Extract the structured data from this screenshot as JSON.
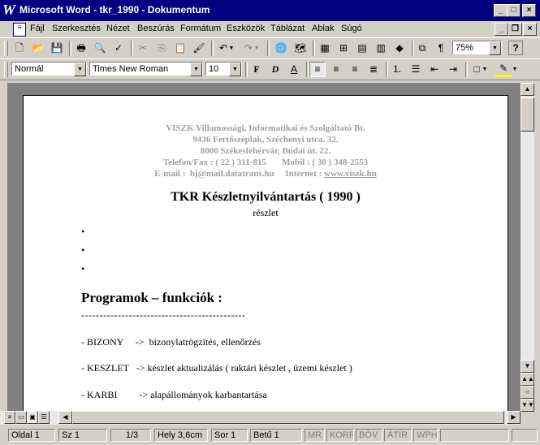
{
  "window": {
    "title": "Microsoft Word - tkr_1990 - Dokumentum",
    "app_icon": "W",
    "controls": [
      "_",
      "□",
      "×"
    ]
  },
  "doc_controls": [
    "_",
    "❐",
    "×"
  ],
  "menu": [
    "Fájl",
    "Szerkesztés",
    "Nézet",
    "Beszúrás",
    "Formátum",
    "Eszközök",
    "Táblázat",
    "Ablak",
    "Súgó"
  ],
  "toolbar": {
    "zoom": "75%",
    "help_label": "?"
  },
  "format": {
    "style": "Normál",
    "font": "Times New Roman",
    "size": "10",
    "bold_label": "F",
    "italic_label": "D",
    "underline_label": "A"
  },
  "document": {
    "header_lines": [
      "VISZK Villamossági, Informatikai és Szolgáltató Bt.",
      "9436 Fertőszéplak, Széchenyi utca. 32.",
      "8000 Székesfehérvár, Budai út. 22.",
      "Telefon/Fax : ( 22 ) 311-815       Mobil : ( 30 ) 348-2553"
    ],
    "email_line": "E-mail :  bj@mail.datatrans.hu     Internet : ",
    "website": "www.viszk.hu",
    "title": "TKR Készletnyilvántartás ( 1990 )",
    "subtitle": "részlet",
    "bullet": "•",
    "section_heading": "Programok – funkciók :",
    "dash_line": "---------------------------------------------",
    "items": [
      "- BIZONY     ->  bizonylatrögzítés, ellenőrzés",
      "- KESZLET   -> készlet aktualizálás ( raktári készlet , üzemi készlet )",
      "- KARBI         -> alapállományok karbantartása"
    ]
  },
  "statusbar": {
    "page": "Oldal  1",
    "section": "Sz  1",
    "pages": "1/3",
    "position": "Hely  3,6cm",
    "line": "Sor  1",
    "column": "Betű  1",
    "modes": [
      "MR",
      "KORR",
      "BŐV",
      "ÁTÍR",
      "WPH"
    ]
  }
}
